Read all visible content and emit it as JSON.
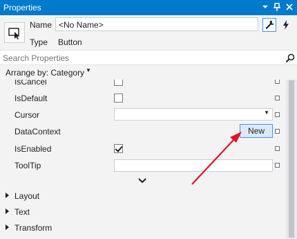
{
  "window": {
    "title": "Properties"
  },
  "header": {
    "name_label": "Name",
    "name_value": "<No Name>",
    "type_label": "Type",
    "type_value": "Button"
  },
  "search": {
    "placeholder": "Search Properties"
  },
  "arrange": {
    "label": "Arrange by: Category"
  },
  "properties": [
    {
      "label": "IsCancel",
      "editor": "checkbox",
      "checked": false
    },
    {
      "label": "IsDefault",
      "editor": "checkbox",
      "checked": false
    },
    {
      "label": "Cursor",
      "editor": "combo",
      "value": ""
    },
    {
      "label": "DataContext",
      "editor": "button",
      "button_label": "New"
    },
    {
      "label": "IsEnabled",
      "editor": "checkbox",
      "checked": true
    },
    {
      "label": "ToolTip",
      "editor": "text",
      "value": ""
    }
  ],
  "categories": [
    {
      "label": "Layout"
    },
    {
      "label": "Text"
    },
    {
      "label": "Transform"
    }
  ],
  "icons": {
    "dropdown": "chevron-down-icon",
    "pin": "pin-icon",
    "close": "close-icon",
    "object": "button-object-icon",
    "properties": "wrench-icon",
    "events": "lightning-bolt-icon",
    "search": "search-icon",
    "expand": "expand-chevron-icon",
    "collapsed_category": "triangle-right-icon",
    "property_marker": "advanced-options-square-icon",
    "annotation": "red-arrow-icon"
  },
  "colors": {
    "title_bar": "#007acc",
    "accent": "#3399ff",
    "annotation_arrow": "#e81123"
  }
}
